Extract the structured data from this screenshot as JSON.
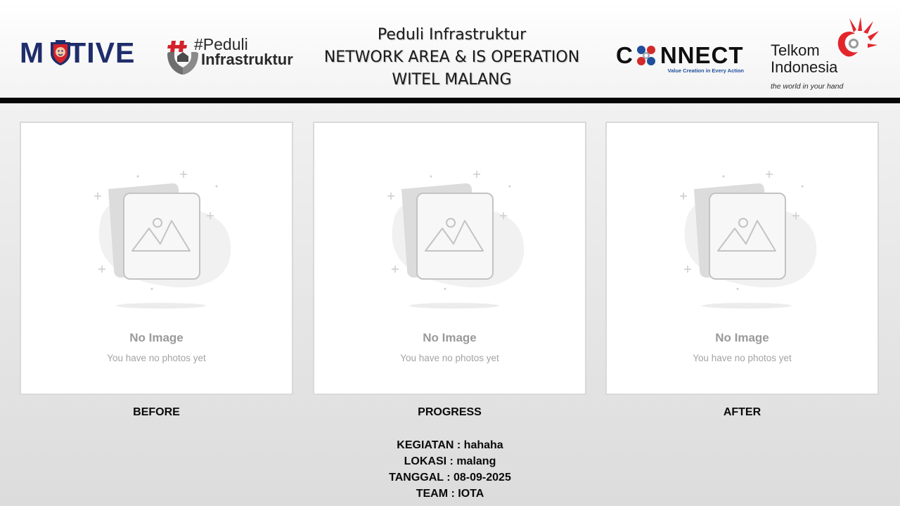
{
  "header": {
    "logos": {
      "motive": {
        "text_left": "M",
        "text_right": "TIVE",
        "icon": "lion-emblem-icon"
      },
      "peduli": {
        "line1": "#Peduli",
        "line2": "Infrastruktur",
        "icon": "hands-emblem-icon"
      },
      "connect": {
        "text_left": "C",
        "text_right": "NNECT",
        "tagline": "Value Creation in Every Action",
        "icon": "connect-ring-icon"
      },
      "telkom": {
        "name_line1": "Telkom",
        "name_line2": "Indonesia",
        "tagline": "the world in your hand",
        "icon": "telkom-brand-icon"
      }
    },
    "title": {
      "line1": "Peduli Infrastruktur",
      "line2": "NETWORK AREA & IS OPERATION",
      "line3": "WITEL MALANG"
    }
  },
  "photos": [
    {
      "caption": "BEFORE",
      "placeholder_title": "No Image",
      "placeholder_subtitle": "You have no photos yet"
    },
    {
      "caption": "PROGRESS",
      "placeholder_title": "No Image",
      "placeholder_subtitle": "You have no photos yet"
    },
    {
      "caption": "AFTER",
      "placeholder_title": "No Image",
      "placeholder_subtitle": "You have no photos yet"
    }
  ],
  "info": {
    "kegiatan": "KEGIATAN : hahaha",
    "lokasi": "LOKASI : malang",
    "tanggal": "TANGGAL : 08-09-2025",
    "team": "TEAM : IOTA"
  },
  "colors": {
    "motive_navy": "#1f2d6b",
    "motive_red": "#d3222a",
    "connect_blue": "#1f4f9c",
    "connect_red": "#d32a2a",
    "telkom_red": "#e3262c",
    "header_bar": "#050505",
    "placeholder_gray": "#9a9a9a"
  }
}
